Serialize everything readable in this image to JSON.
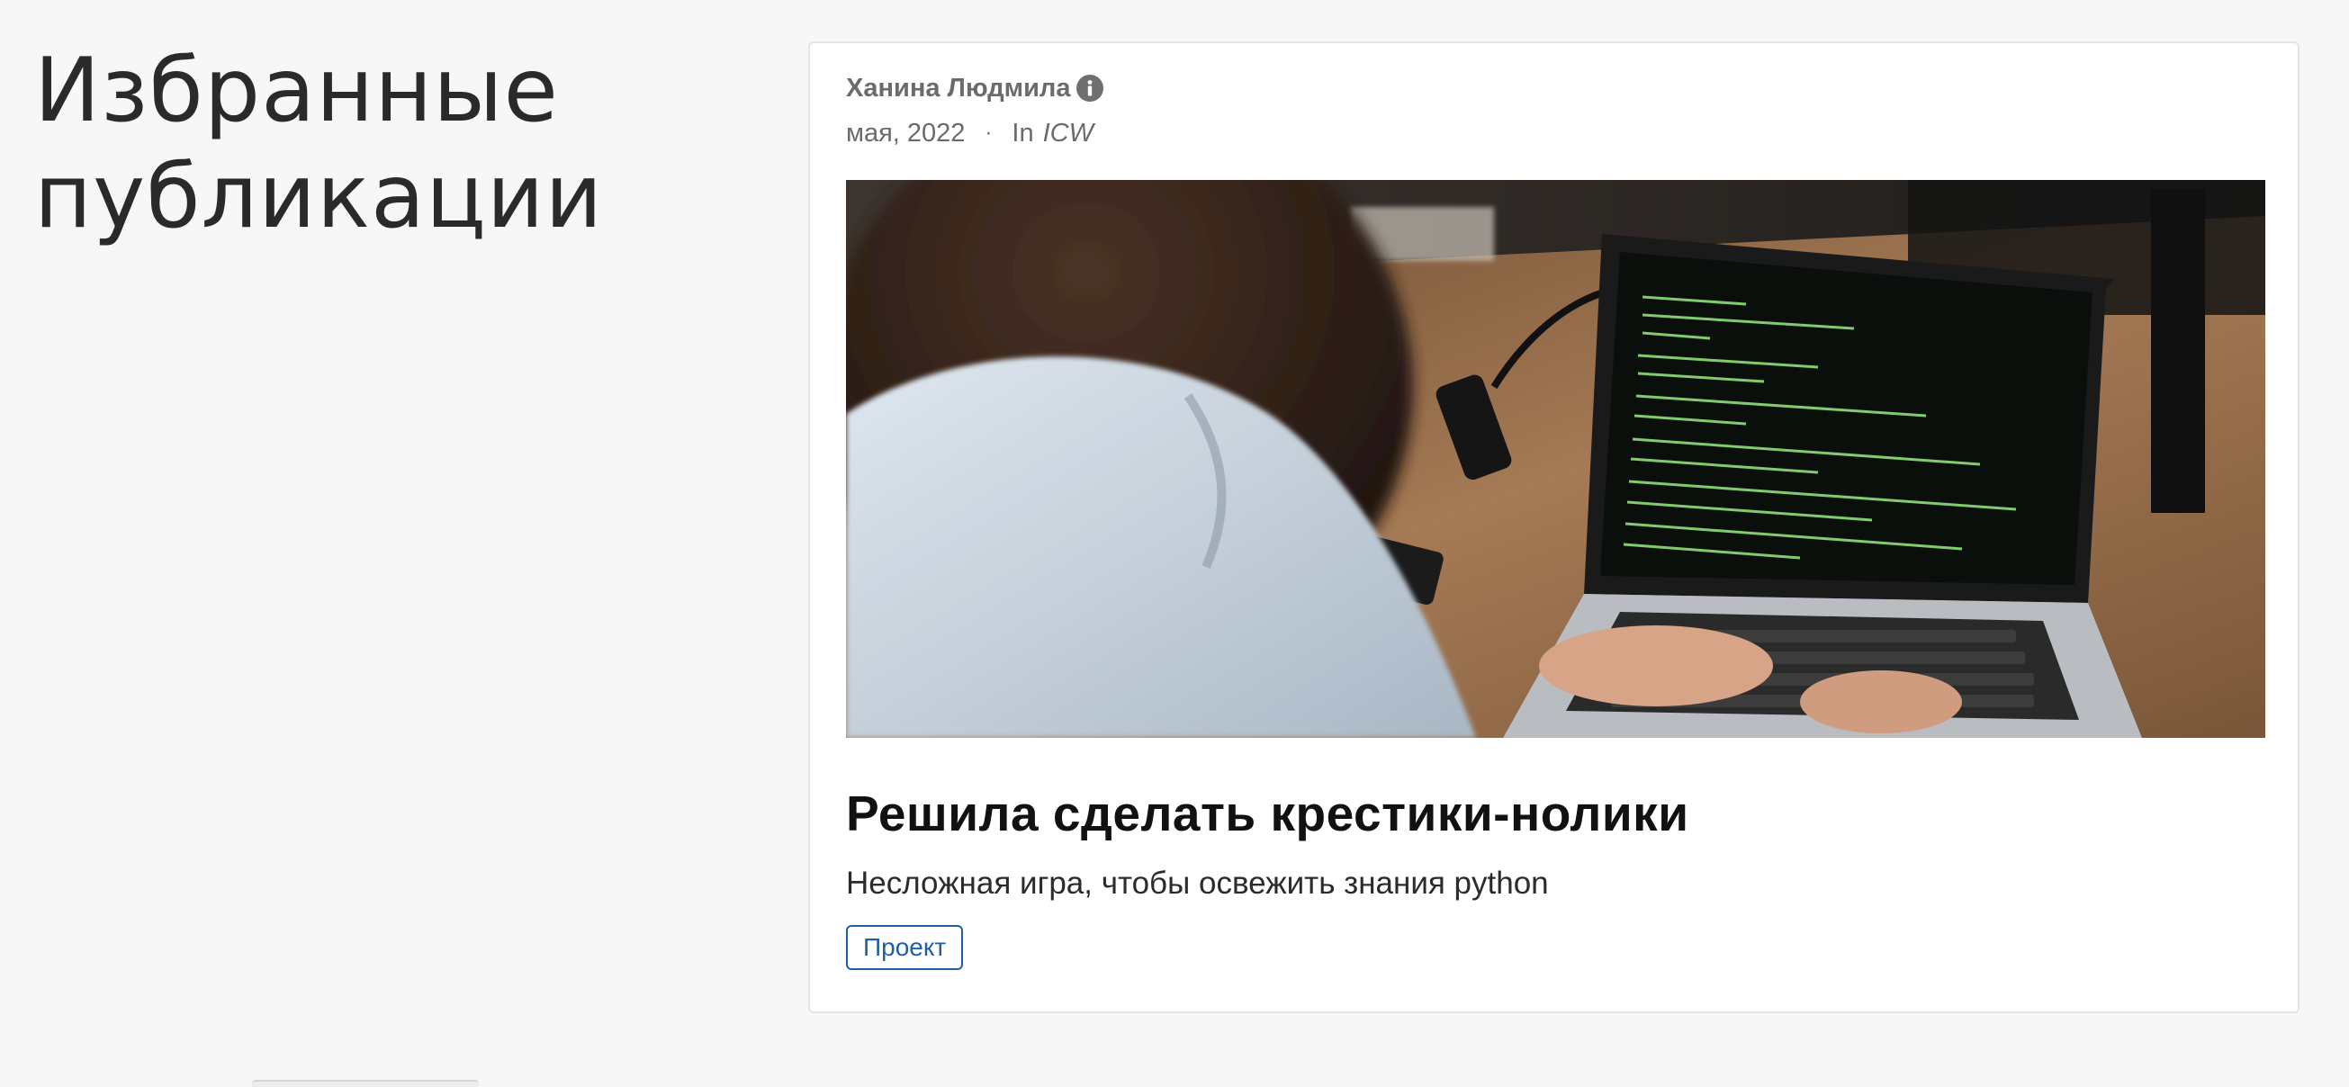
{
  "section": {
    "heading": "Избранные публикации"
  },
  "post": {
    "author": "Ханина Людмила",
    "author_info_icon": "info-icon",
    "date": "мая, 2022",
    "separator": "·",
    "in_label": "In",
    "category": "ICW",
    "image_subject": "person typing on laptop showing green terminal code",
    "title": "Решила сделать крестики-нолики",
    "excerpt": "Несложная игра, чтобы освежить знания python",
    "tag": "Проект"
  },
  "colors": {
    "page_background": "#f7f7f7",
    "card_background": "#ffffff",
    "meta_text": "#6b6b6b",
    "title_text": "#111111",
    "tag_accent": "#1f5fa8",
    "terminal_text": "#8fe07a"
  }
}
